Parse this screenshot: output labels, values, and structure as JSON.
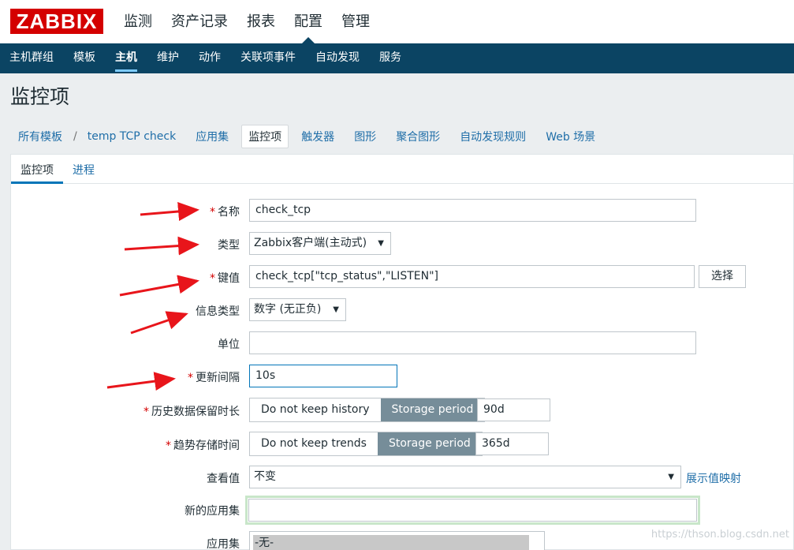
{
  "logo": "ZABBIX",
  "top_nav": [
    "监测",
    "资产记录",
    "报表",
    "配置",
    "管理"
  ],
  "sub_nav": [
    "主机群组",
    "模板",
    "主机",
    "维护",
    "动作",
    "关联项事件",
    "自动发现",
    "服务"
  ],
  "page_title": "监控项",
  "item_nav": {
    "all_templates": "所有模板",
    "separator": "/",
    "template_name": "temp TCP check",
    "links": [
      "应用集",
      "监控项",
      "触发器",
      "图形",
      "聚合图形",
      "自动发现规则",
      "Web 场景"
    ]
  },
  "tabs": [
    "监控项",
    "进程"
  ],
  "form": {
    "required_mark": "*",
    "name_label": "名称",
    "name_value": "check_tcp",
    "type_label": "类型",
    "type_value": "Zabbix客户端(主动式)",
    "key_label": "键值",
    "key_value": "check_tcp[\"tcp_status\",\"LISTEN\"]",
    "key_select_button": "选择",
    "info_type_label": "信息类型",
    "info_type_value": "数字 (无正负)",
    "units_label": "单位",
    "units_value": "",
    "interval_label": "更新间隔",
    "interval_value": "10s",
    "history_label": "历史数据保留时长",
    "history_opt_no": "Do not keep history",
    "history_opt_storage": "Storage period",
    "history_value": "90d",
    "trends_label": "趋势存储时间",
    "trends_opt_no": "Do not keep trends",
    "trends_opt_storage": "Storage period",
    "trends_value": "365d",
    "valuemap_label": "查看值",
    "valuemap_value": "不变",
    "valuemap_link": "展示值映射",
    "new_app_label": "新的应用集",
    "new_app_value": "",
    "apps_label": "应用集",
    "apps_item": "-无-"
  },
  "watermark": "https://thson.blog.csdn.net",
  "colors": {
    "brand": "#d40000",
    "nav": "#0b4463",
    "annotation_arrow": "#e8151b"
  }
}
